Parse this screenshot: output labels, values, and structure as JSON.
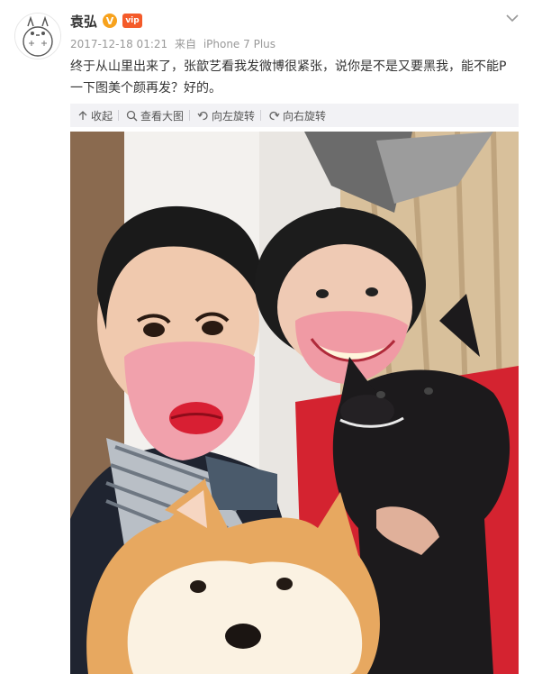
{
  "post": {
    "username": "袁弘",
    "verified_badge": "V",
    "vip_badge": "vip",
    "timestamp": "2017-12-18 01:21",
    "source_prefix": "来自",
    "device": "iPhone 7 Plus",
    "text": "终于从山里出来了，张歆艺看我发微博很紧张，说你是不是又要黑我，能不能P一下图美个颜再发？好的。"
  },
  "actions": {
    "collapse": "收起",
    "view_large": "查看大图",
    "rotate_left": "向左旋转",
    "rotate_right": "向右旋转"
  },
  "icons": {
    "avatar": "totoro-avatar",
    "header_menu": "chevron-down-icon",
    "collapse": "collapse-icon",
    "view_large": "magnify-icon",
    "rotate_left": "rotate-left-icon",
    "rotate_right": "rotate-right-icon"
  },
  "colors": {
    "badge_v": "#f7a21d",
    "badge_vip": "#f45b2a",
    "action_bar_bg": "#f2f2f5",
    "meta_text": "#999999"
  }
}
